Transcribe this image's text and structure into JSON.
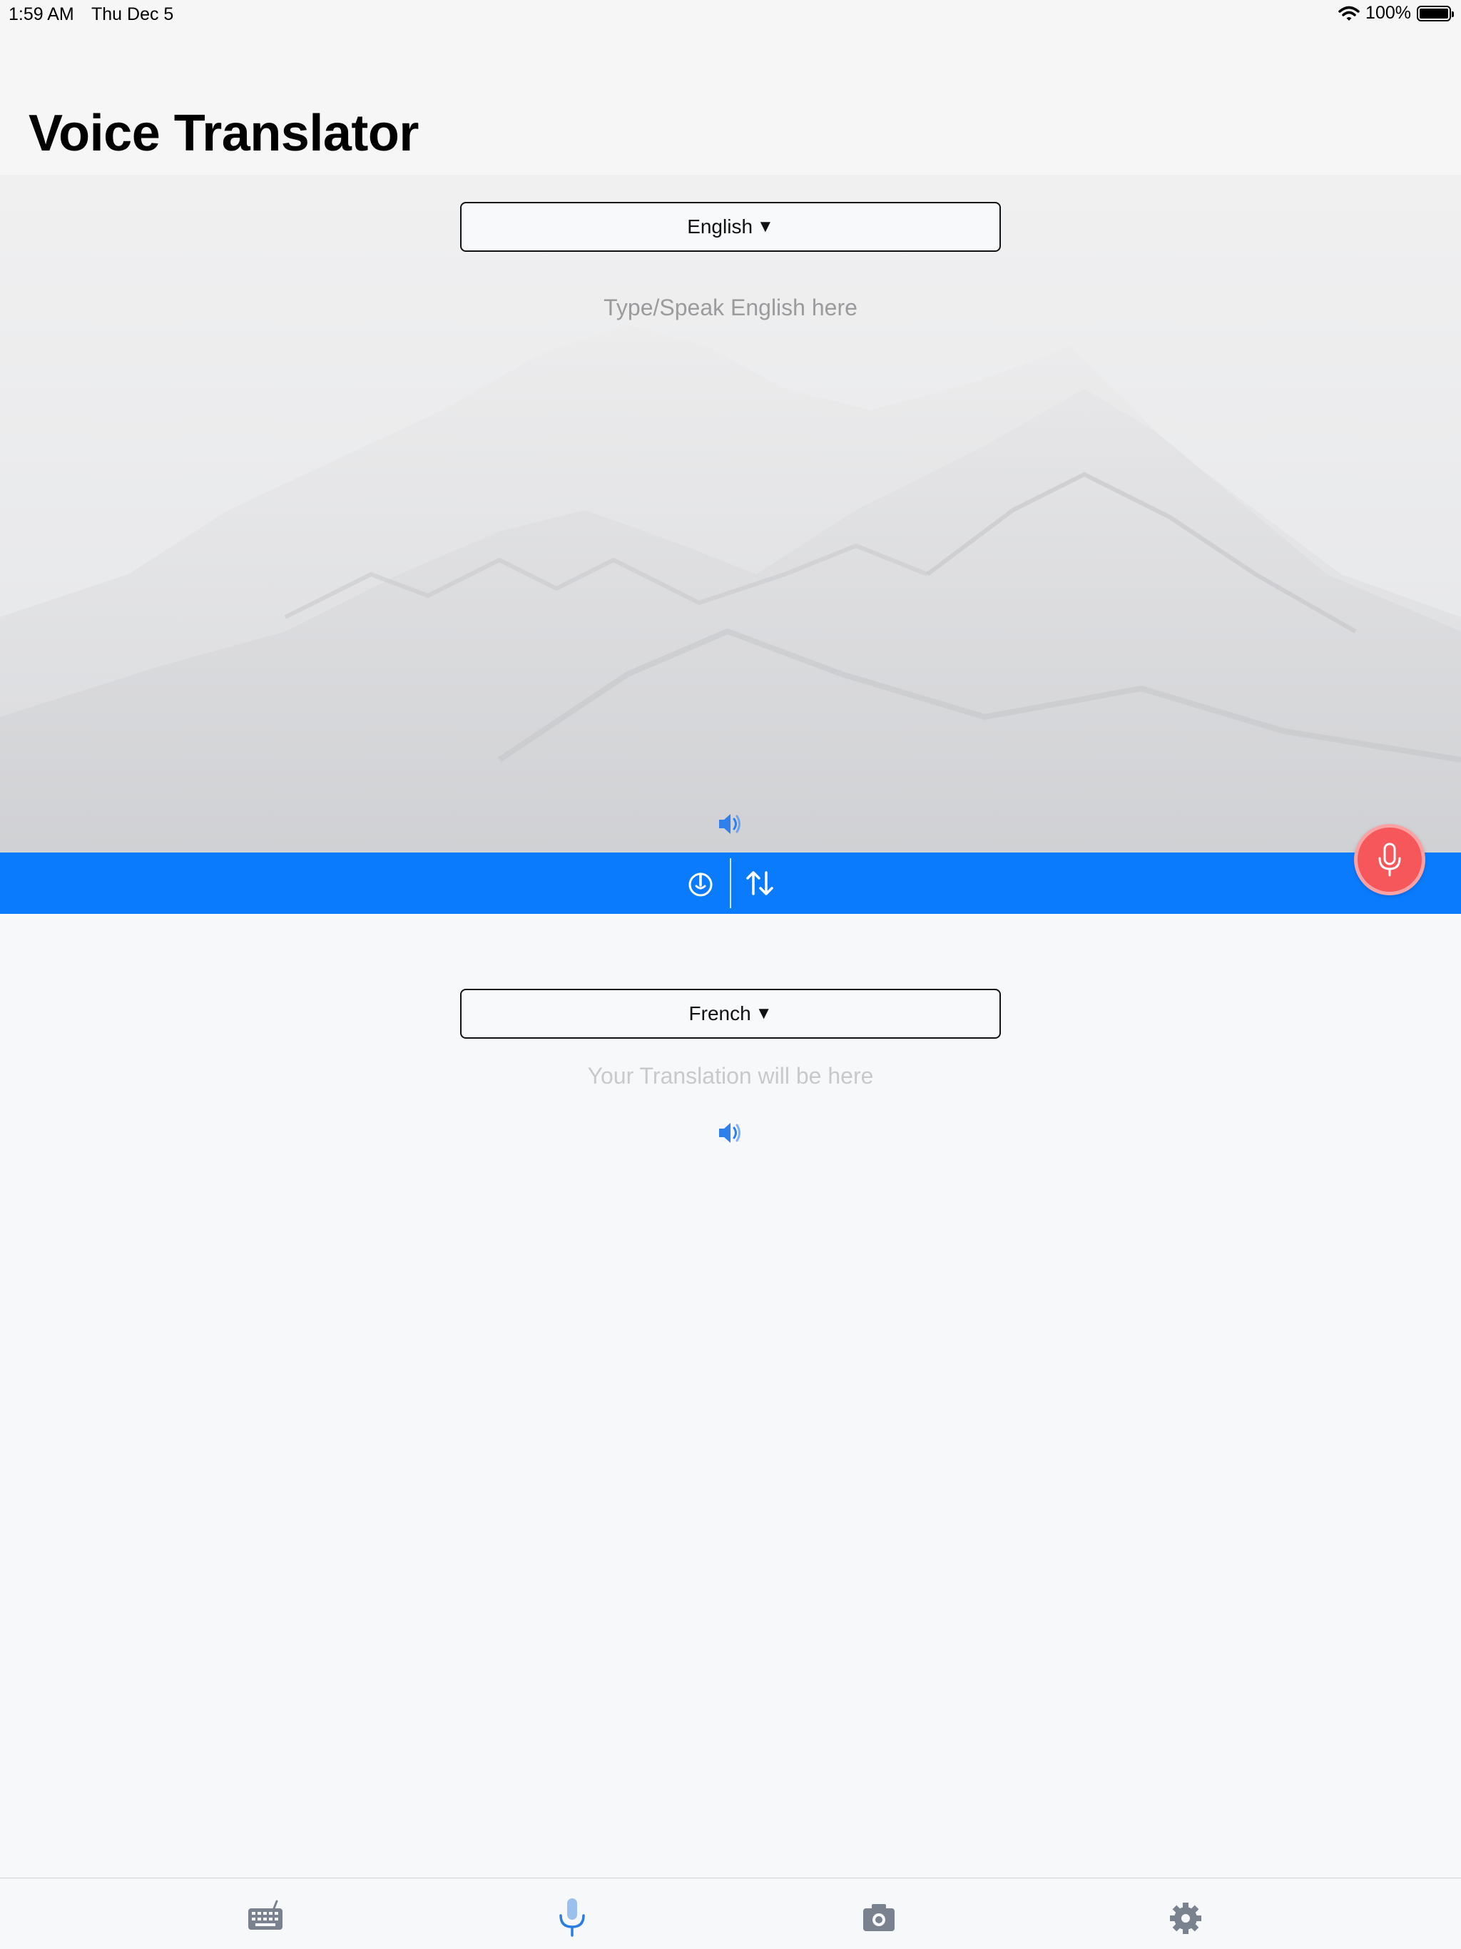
{
  "status_bar": {
    "time": "1:59 AM",
    "date": "Thu Dec 5",
    "battery": "100%",
    "battery_level": 1.0
  },
  "header": {
    "title": "Voice Translator"
  },
  "source": {
    "language": "English",
    "caret": "▼",
    "placeholder": "Type/Speak English here",
    "speaker_icon": "speaker-icon"
  },
  "action_bar": {
    "left_icon": "power-tap-icon",
    "right_icon": "swap-arrows-icon",
    "color": "#0b7bfe"
  },
  "mic_button": {
    "icon": "microphone-icon",
    "color": "#f5575a"
  },
  "target": {
    "language": "French",
    "caret": "▼",
    "placeholder": "Your Translation will be here",
    "speaker_icon": "speaker-icon"
  },
  "tabbar": {
    "tabs": [
      {
        "icon": "keyboard-icon",
        "active": false
      },
      {
        "icon": "microphone-icon",
        "active": true
      },
      {
        "icon": "camera-icon",
        "active": false
      },
      {
        "icon": "gear-icon",
        "active": false
      }
    ],
    "active_color": "#2a7de1",
    "inactive_color": "#7a8290"
  }
}
